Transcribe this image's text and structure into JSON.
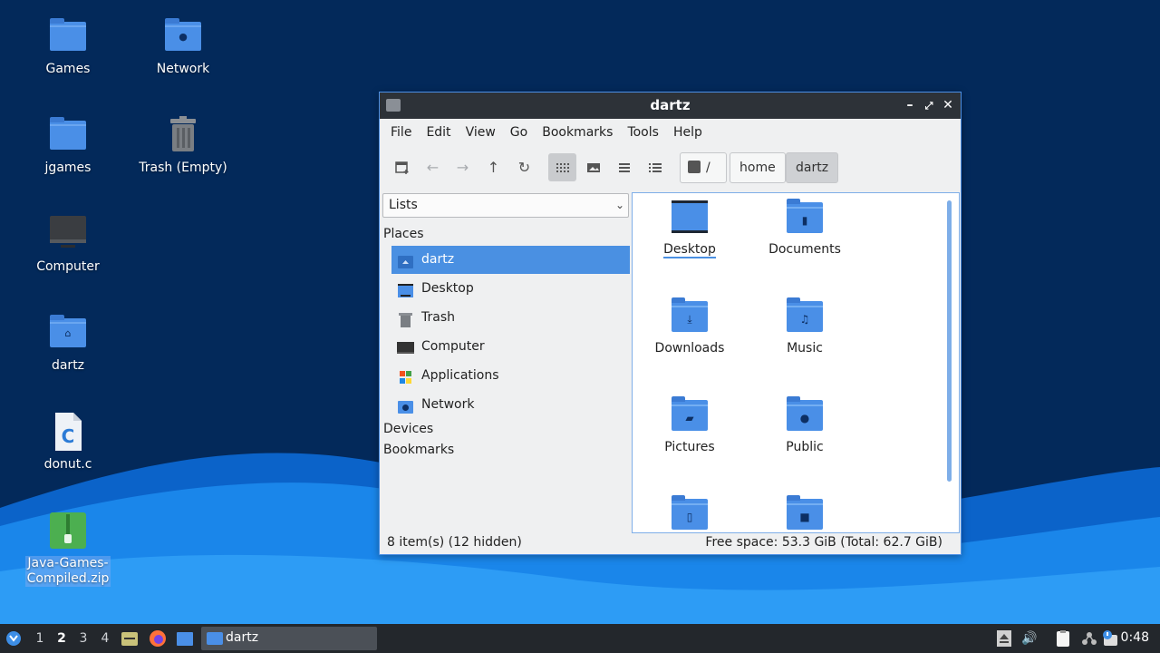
{
  "desktop": {
    "icons": [
      {
        "label": "Games",
        "icon": "folder-icon"
      },
      {
        "label": "Network",
        "icon": "network-folder-icon"
      },
      {
        "label": "jgames",
        "icon": "folder-icon"
      },
      {
        "label": "Trash (Empty)",
        "icon": "trash-icon"
      },
      {
        "label": "Computer",
        "icon": "computer-icon"
      },
      {
        "label": "dartz",
        "icon": "home-folder-icon"
      },
      {
        "label": "donut.c",
        "icon": "c-source-file-icon"
      },
      {
        "label": "Java-Games-Compiled.zip",
        "label_line1": "Java-Games-",
        "label_line2": "Compiled.zip",
        "icon": "zip-archive-icon"
      }
    ]
  },
  "window": {
    "title": "dartz",
    "menu": [
      "File",
      "Edit",
      "View",
      "Go",
      "Bookmarks",
      "Tools",
      "Help"
    ],
    "breadcrumb": {
      "root": "/",
      "parts": [
        "home",
        "dartz"
      ]
    },
    "side_mode": "Lists",
    "places_heading": "Places",
    "places": [
      {
        "label": "dartz",
        "icon": "home-icon",
        "selected": true
      },
      {
        "label": "Desktop",
        "icon": "desktop-icon"
      },
      {
        "label": "Trash",
        "icon": "trash-icon"
      },
      {
        "label": "Computer",
        "icon": "computer-icon"
      },
      {
        "label": "Applications",
        "icon": "applications-icon"
      },
      {
        "label": "Network",
        "icon": "network-icon"
      }
    ],
    "devices_heading": "Devices",
    "bookmarks_heading": "Bookmarks",
    "files": [
      {
        "label": "Desktop",
        "icon": "desktop-folder-icon"
      },
      {
        "label": "Documents",
        "icon": "documents-folder-icon"
      },
      {
        "label": "Downloads",
        "icon": "downloads-folder-icon"
      },
      {
        "label": "Music",
        "icon": "music-folder-icon"
      },
      {
        "label": "Pictures",
        "icon": "pictures-folder-icon"
      },
      {
        "label": "Public",
        "icon": "public-folder-icon"
      },
      {
        "label": "",
        "icon": "templates-folder-icon"
      },
      {
        "label": "",
        "icon": "videos-folder-icon"
      }
    ],
    "status_left": "8 item(s) (12 hidden)",
    "status_right": "Free space: 53.3 GiB (Total: 62.7 GiB)"
  },
  "taskbar": {
    "workspaces": [
      "1",
      "2",
      "3",
      "4"
    ],
    "current_workspace": "2",
    "task_label": "dartz",
    "clock": "0:48"
  },
  "colors": {
    "accent": "#4a90e2",
    "folder": "#4a8fe7",
    "titlebar": "#2d3238",
    "desktop": "#03295a"
  }
}
